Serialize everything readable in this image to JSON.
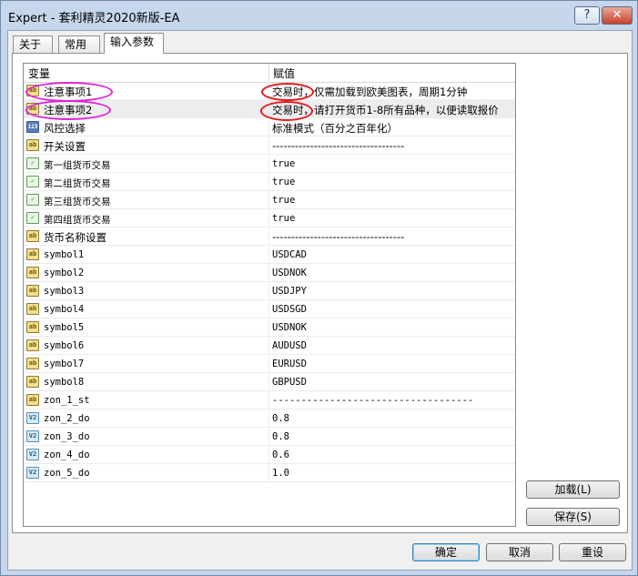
{
  "window": {
    "title": "Expert - 套利精灵2020新版-EA",
    "help_label": "?",
    "close_label": "✕"
  },
  "tabs": [
    {
      "label": "关于",
      "active": false
    },
    {
      "label": "常用",
      "active": false
    },
    {
      "label": "输入参数",
      "active": true
    }
  ],
  "table": {
    "headers": {
      "name": "变量",
      "value": "赋值"
    },
    "rows": [
      {
        "icon": "string-icon",
        "name": "注意事项1",
        "value": "交易时，仅需加载到欧美图表，周期1分钟",
        "mono": false
      },
      {
        "icon": "string-icon",
        "name": "注意事项2",
        "value": "交易时，请打开货币1-8所有品种，以便读取报价",
        "mono": false,
        "selected": true
      },
      {
        "icon": "integer-icon",
        "name": "风控选择",
        "value": "标准模式（百分之百年化）",
        "mono": false
      },
      {
        "icon": "string-icon",
        "name": "开关设置",
        "value": "-----------------------------------",
        "mono": false
      },
      {
        "icon": "bool-icon",
        "name": "第一组货币交易",
        "value": "true",
        "mono": true
      },
      {
        "icon": "bool-icon",
        "name": "第二组货币交易",
        "value": "true",
        "mono": true
      },
      {
        "icon": "bool-icon",
        "name": "第三组货币交易",
        "value": "true",
        "mono": true
      },
      {
        "icon": "bool-icon",
        "name": "第四组货币交易",
        "value": "true",
        "mono": true
      },
      {
        "icon": "string-icon",
        "name": "货币名称设置",
        "value": "-----------------------------------",
        "mono": false
      },
      {
        "icon": "string-icon",
        "name": "symbol1",
        "value": "USDCAD",
        "mono": true
      },
      {
        "icon": "string-icon",
        "name": "symbol2",
        "value": "USDNOK",
        "mono": true
      },
      {
        "icon": "string-icon",
        "name": "symbol3",
        "value": "USDJPY",
        "mono": true
      },
      {
        "icon": "string-icon",
        "name": "symbol4",
        "value": "USDSGD",
        "mono": true
      },
      {
        "icon": "string-icon",
        "name": "symbol5",
        "value": "USDNOK",
        "mono": true
      },
      {
        "icon": "string-icon",
        "name": "symbol6",
        "value": "AUDUSD",
        "mono": true
      },
      {
        "icon": "string-icon",
        "name": "symbol7",
        "value": "EURUSD",
        "mono": true
      },
      {
        "icon": "string-icon",
        "name": "symbol8",
        "value": "GBPUSD",
        "mono": true
      },
      {
        "icon": "string-icon",
        "name": "zon_1_st",
        "value": "-----------------------------------",
        "mono": true
      },
      {
        "icon": "double-icon",
        "name": "zon_2_do",
        "value": "0.8",
        "mono": true
      },
      {
        "icon": "double-icon",
        "name": "zon_3_do",
        "value": "0.8",
        "mono": true
      },
      {
        "icon": "double-icon",
        "name": "zon_4_do",
        "value": "0.6",
        "mono": true
      },
      {
        "icon": "double-icon",
        "name": "zon_5_do",
        "value": "1.0",
        "mono": true
      }
    ]
  },
  "side_buttons": {
    "load": "加载(L)",
    "save": "保存(S)"
  },
  "footer_buttons": {
    "ok": "确定",
    "cancel": "取消",
    "reset": "重设"
  },
  "icon_glyphs": {
    "string-icon": "ab",
    "integer-icon": "123",
    "bool-icon": "✓",
    "double-icon": "V2"
  },
  "annotation_colors": {
    "magenta": "#e020d8",
    "red": "#e31b1b"
  }
}
